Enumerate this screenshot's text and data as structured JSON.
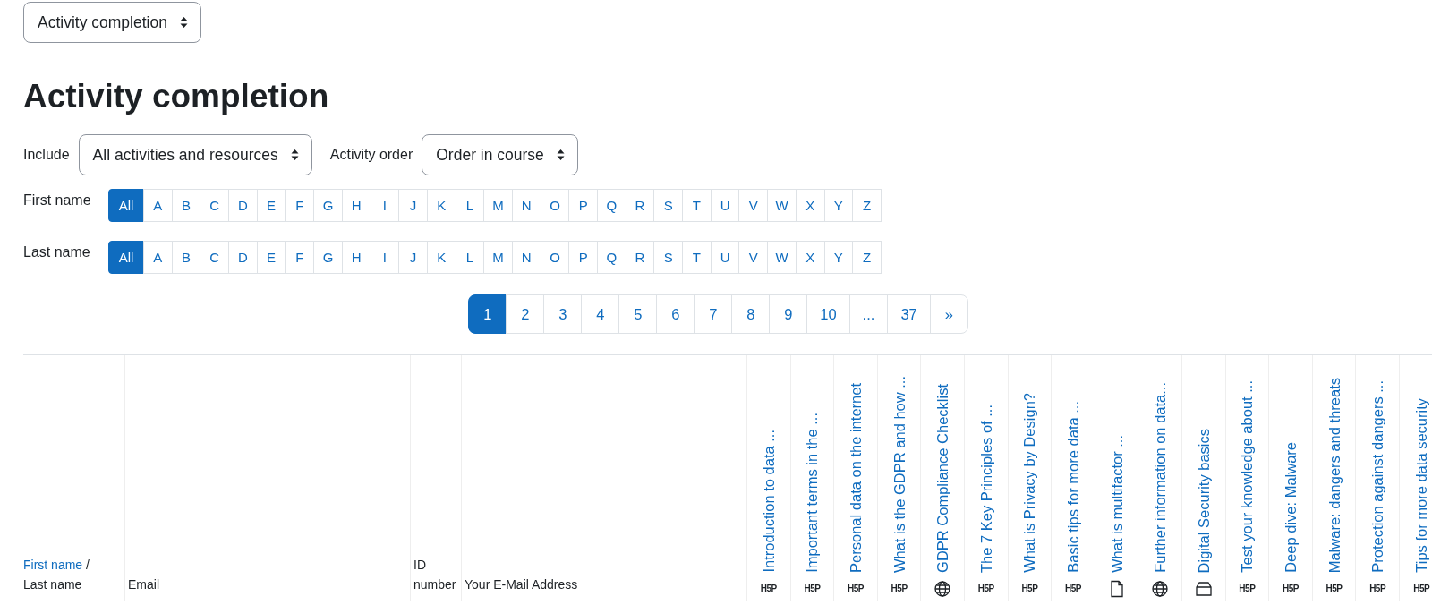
{
  "report_select": {
    "value": "Activity completion"
  },
  "heading": "Activity completion",
  "filters": [
    {
      "label": "Include",
      "value": "All activities and resources"
    },
    {
      "label": "Activity order",
      "value": "Order in course"
    }
  ],
  "initials_bars": [
    {
      "label": "First name",
      "letters": [
        {
          "text": "All",
          "selected": true
        },
        {
          "text": "A",
          "selected": false
        },
        {
          "text": "B",
          "selected": false
        },
        {
          "text": "C",
          "selected": false
        },
        {
          "text": "D",
          "selected": false
        },
        {
          "text": "E",
          "selected": false
        },
        {
          "text": "F",
          "selected": false
        },
        {
          "text": "G",
          "selected": false
        },
        {
          "text": "H",
          "selected": false
        },
        {
          "text": "I",
          "selected": false
        },
        {
          "text": "J",
          "selected": false
        },
        {
          "text": "K",
          "selected": false
        },
        {
          "text": "L",
          "selected": false
        },
        {
          "text": "M",
          "selected": false
        },
        {
          "text": "N",
          "selected": false
        },
        {
          "text": "O",
          "selected": false
        },
        {
          "text": "P",
          "selected": false
        },
        {
          "text": "Q",
          "selected": false
        },
        {
          "text": "R",
          "selected": false
        },
        {
          "text": "S",
          "selected": false
        },
        {
          "text": "T",
          "selected": false
        },
        {
          "text": "U",
          "selected": false
        },
        {
          "text": "V",
          "selected": false
        },
        {
          "text": "W",
          "selected": false
        },
        {
          "text": "X",
          "selected": false
        },
        {
          "text": "Y",
          "selected": false
        },
        {
          "text": "Z",
          "selected": false
        }
      ]
    },
    {
      "label": "Last name",
      "letters": [
        {
          "text": "All",
          "selected": true
        },
        {
          "text": "A",
          "selected": false
        },
        {
          "text": "B",
          "selected": false
        },
        {
          "text": "C",
          "selected": false
        },
        {
          "text": "D",
          "selected": false
        },
        {
          "text": "E",
          "selected": false
        },
        {
          "text": "F",
          "selected": false
        },
        {
          "text": "G",
          "selected": false
        },
        {
          "text": "H",
          "selected": false
        },
        {
          "text": "I",
          "selected": false
        },
        {
          "text": "J",
          "selected": false
        },
        {
          "text": "K",
          "selected": false
        },
        {
          "text": "L",
          "selected": false
        },
        {
          "text": "M",
          "selected": false
        },
        {
          "text": "N",
          "selected": false
        },
        {
          "text": "O",
          "selected": false
        },
        {
          "text": "P",
          "selected": false
        },
        {
          "text": "Q",
          "selected": false
        },
        {
          "text": "R",
          "selected": false
        },
        {
          "text": "S",
          "selected": false
        },
        {
          "text": "T",
          "selected": false
        },
        {
          "text": "U",
          "selected": false
        },
        {
          "text": "V",
          "selected": false
        },
        {
          "text": "W",
          "selected": false
        },
        {
          "text": "X",
          "selected": false
        },
        {
          "text": "Y",
          "selected": false
        },
        {
          "text": "Z",
          "selected": false
        }
      ]
    }
  ],
  "pagination": [
    {
      "text": "1",
      "selected": true
    },
    {
      "text": "2",
      "selected": false
    },
    {
      "text": "3",
      "selected": false
    },
    {
      "text": "4",
      "selected": false
    },
    {
      "text": "5",
      "selected": false
    },
    {
      "text": "6",
      "selected": false
    },
    {
      "text": "7",
      "selected": false
    },
    {
      "text": "8",
      "selected": false
    },
    {
      "text": "9",
      "selected": false
    },
    {
      "text": "10",
      "selected": false
    },
    {
      "text": "...",
      "selected": false
    },
    {
      "text": "37",
      "selected": false
    },
    {
      "text": "»",
      "selected": false
    }
  ],
  "table": {
    "name_header": {
      "first": "First name",
      "separator": "/",
      "last": "Last name"
    },
    "columns": [
      "Email",
      "ID number",
      "Your E-Mail Address"
    ],
    "activities": [
      {
        "title": "Introduction to data ...",
        "kind": "h5p",
        "logo": "H5P"
      },
      {
        "title": "Important terms in the ...",
        "kind": "h5p",
        "logo": "H5P"
      },
      {
        "title": "Personal data on the internet",
        "kind": "h5p",
        "logo": "H5P"
      },
      {
        "title": "What is the GDPR and how ...",
        "kind": "h5p",
        "logo": "H5P"
      },
      {
        "title": "GDPR Compliance Checklist",
        "kind": "url"
      },
      {
        "title": "The 7 Key Principles of ...",
        "kind": "h5p",
        "logo": "H5P"
      },
      {
        "title": "What is Privacy by Design?",
        "kind": "h5p",
        "logo": "H5P"
      },
      {
        "title": "Basic tips for more data ...",
        "kind": "h5p",
        "logo": "H5P"
      },
      {
        "title": "What is multifactor ...",
        "kind": "page"
      },
      {
        "title": "Further information on data...",
        "kind": "url"
      },
      {
        "title": "Digital Security basics",
        "kind": "label"
      },
      {
        "title": "Test your knowledge about ...",
        "kind": "h5p",
        "logo": "H5P"
      },
      {
        "title": "Deep dive: Malware",
        "kind": "h5p",
        "logo": "H5P"
      },
      {
        "title": "Malware: dangers and threats",
        "kind": "h5p",
        "logo": "H5P"
      },
      {
        "title": "Protection against dangers ...",
        "kind": "h5p",
        "logo": "H5P"
      },
      {
        "title": "Tips for more data security",
        "kind": "h5p",
        "logo": "H5P"
      }
    ]
  }
}
